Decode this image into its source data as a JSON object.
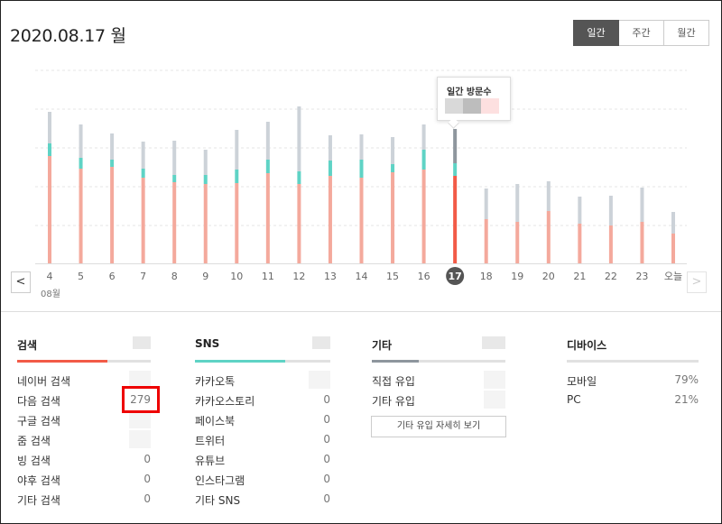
{
  "header": {
    "date": "2020.08.17 월"
  },
  "period_tabs": {
    "daily": "일간",
    "weekly": "주간",
    "monthly": "월간"
  },
  "nav": {
    "prev": "<",
    "next": ">"
  },
  "month_label": "08월",
  "tooltip": {
    "title": "일간 방문수"
  },
  "chart_data": {
    "type": "bar",
    "categories": [
      "4",
      "5",
      "6",
      "7",
      "8",
      "9",
      "10",
      "11",
      "12",
      "13",
      "14",
      "15",
      "16",
      "17",
      "18",
      "19",
      "20",
      "21",
      "22",
      "23",
      "오늘"
    ],
    "selected_index": 13,
    "grid": true,
    "colors": {
      "search": "#f4a99c",
      "search_selected": "#f25b47",
      "sns": "#5fd3c5",
      "other": "#ccd2d8",
      "other_selected": "#8e969d"
    }
  },
  "sections": {
    "search": {
      "title": "검색",
      "accent": "#f25b47",
      "items": [
        {
          "label": "네이버 검색",
          "value": ""
        },
        {
          "label": "다음 검색",
          "value": "279"
        },
        {
          "label": "구글 검색",
          "value": ""
        },
        {
          "label": "줌 검색",
          "value": ""
        },
        {
          "label": "빙 검색",
          "value": "0"
        },
        {
          "label": "야후 검색",
          "value": "0"
        },
        {
          "label": "기타 검색",
          "value": "0"
        }
      ]
    },
    "sns": {
      "title": "SNS",
      "accent": "#5fd3c5",
      "items": [
        {
          "label": "카카오톡",
          "value": ""
        },
        {
          "label": "카카오스토리",
          "value": "0"
        },
        {
          "label": "페이스북",
          "value": "0"
        },
        {
          "label": "트위터",
          "value": "0"
        },
        {
          "label": "유튜브",
          "value": "0"
        },
        {
          "label": "인스타그램",
          "value": "0"
        },
        {
          "label": "기타 SNS",
          "value": "0"
        }
      ]
    },
    "other": {
      "title": "기타",
      "accent": "#8e969d",
      "items": [
        {
          "label": "직접 유입",
          "value": ""
        },
        {
          "label": "기타 유입",
          "value": ""
        }
      ],
      "detail_button": "기타 유입 자세히 보기"
    },
    "device": {
      "title": "디바이스",
      "items": [
        {
          "label": "모바일",
          "value": "79%"
        },
        {
          "label": "PC",
          "value": "21%"
        }
      ]
    }
  }
}
